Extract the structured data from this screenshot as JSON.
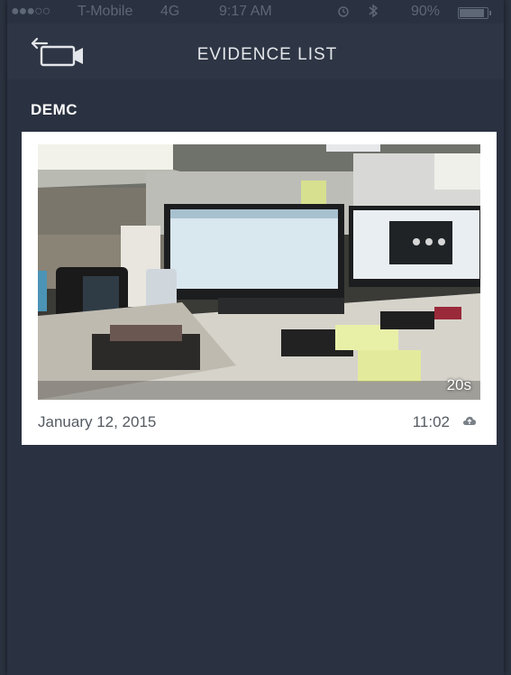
{
  "status_bar": {
    "signal": "●●●○○",
    "carrier": "T-Mobile",
    "network": "4G",
    "time": "9:17 AM",
    "battery_text": "90%",
    "battery_level": 0.9,
    "icons": [
      "alarm-icon",
      "bluetooth-icon",
      "battery-icon"
    ]
  },
  "nav": {
    "title": "EVIDENCE LIST",
    "back_icon": "camera-back-icon"
  },
  "section": {
    "title": "DEMC"
  },
  "evidence": [
    {
      "date": "January 12, 2015",
      "time": "11:02",
      "duration": "20s",
      "thumbnail_icon": "video-thumbnail",
      "status_icon": "upload-icon"
    }
  ],
  "colors": {
    "background": "#2a3140",
    "navbar": "#2e3544",
    "card": "#ffffff",
    "text_light": "#e3e6ea",
    "text_dark": "#555b63"
  }
}
